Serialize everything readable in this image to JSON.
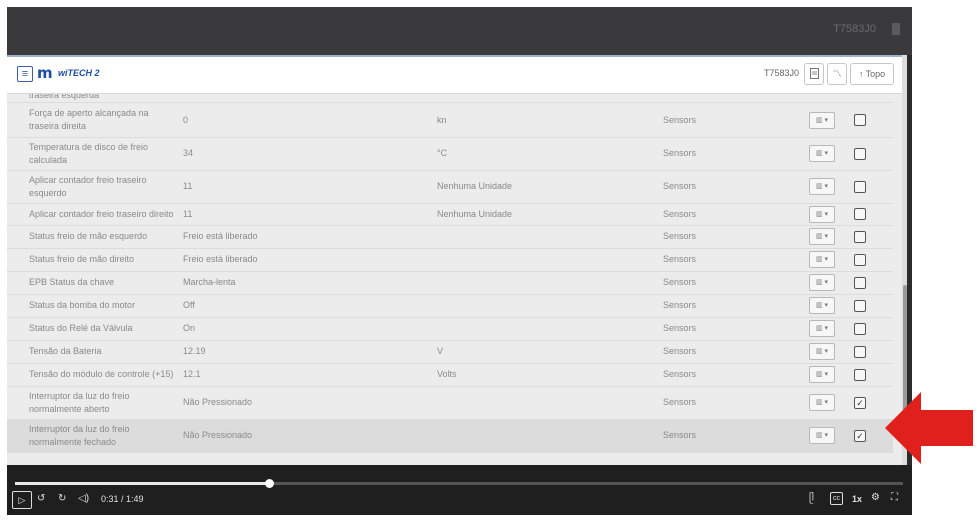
{
  "topbar": {
    "title": "T7583J0"
  },
  "header": {
    "menu_icon": "hamburger-menu-icon",
    "logo_text": "wiTECH 2",
    "vin": "T7583J0",
    "topo_label": "Topo"
  },
  "table": {
    "partial_row": {
      "name": "traseira esquerda"
    },
    "rows": [
      {
        "name": "Força de aperto alcançada na traseira direita",
        "value": "0",
        "unit": "kn",
        "group": "Sensors",
        "checked": false
      },
      {
        "name": "Temperatura de disco de freio calculada",
        "value": "34",
        "unit": "°C",
        "group": "Sensors",
        "checked": false
      },
      {
        "name": "Aplicar contador freio traseiro esquerdo",
        "value": "11",
        "unit": "Nenhuma Unidade",
        "group": "Sensors",
        "checked": false
      },
      {
        "name": "Aplicar contador freio traseiro direito",
        "value": "11",
        "unit": "Nenhuma Unidade",
        "group": "Sensors",
        "checked": false
      },
      {
        "name": "Status freio de mão esquerdo",
        "value": "Freio está liberado",
        "unit": "",
        "group": "Sensors",
        "checked": false
      },
      {
        "name": "Status freio de mão direito",
        "value": "Freio está liberado",
        "unit": "",
        "group": "Sensors",
        "checked": false
      },
      {
        "name": "EPB Status da chave",
        "value": "Marcha-lenta",
        "unit": "",
        "group": "Sensors",
        "checked": false
      },
      {
        "name": "Status da bomba do motor",
        "value": "Off",
        "unit": "",
        "group": "Sensors",
        "checked": false
      },
      {
        "name": "Status do Relé da Válvula",
        "value": "On",
        "unit": "",
        "group": "Sensors",
        "checked": false
      },
      {
        "name": "Tensão da Bateria",
        "value": "12.19",
        "unit": "V",
        "group": "Sensors",
        "checked": false
      },
      {
        "name": "Tensão do módulo de controle (+15)",
        "value": "12.1",
        "unit": "Volts",
        "group": "Sensors",
        "checked": false
      },
      {
        "name": "Interruptor da luz do freio normalmente aberto",
        "value": "Não Pressionado",
        "unit": "",
        "group": "Sensors",
        "checked": true
      },
      {
        "name": "Interruptor da luz do freio normalmente fechado",
        "value": "Não Pressionado",
        "unit": "",
        "group": "Sensors",
        "checked": true
      }
    ]
  },
  "player": {
    "time": "0:31 / 1:49",
    "progress": 0.286,
    "speed": "1x",
    "play_icon": "play-icon",
    "rewind_icon": "rewind-10-icon",
    "forward_icon": "forward-10-icon",
    "volume_icon": "volume-icon",
    "captions_icon": "captions-icon",
    "settings_icon": "gear-icon",
    "fullscreen_icon": "fullscreen-icon"
  },
  "colors": {
    "accent": "#1e4fa3",
    "annotation_arrow": "#e0201c"
  }
}
